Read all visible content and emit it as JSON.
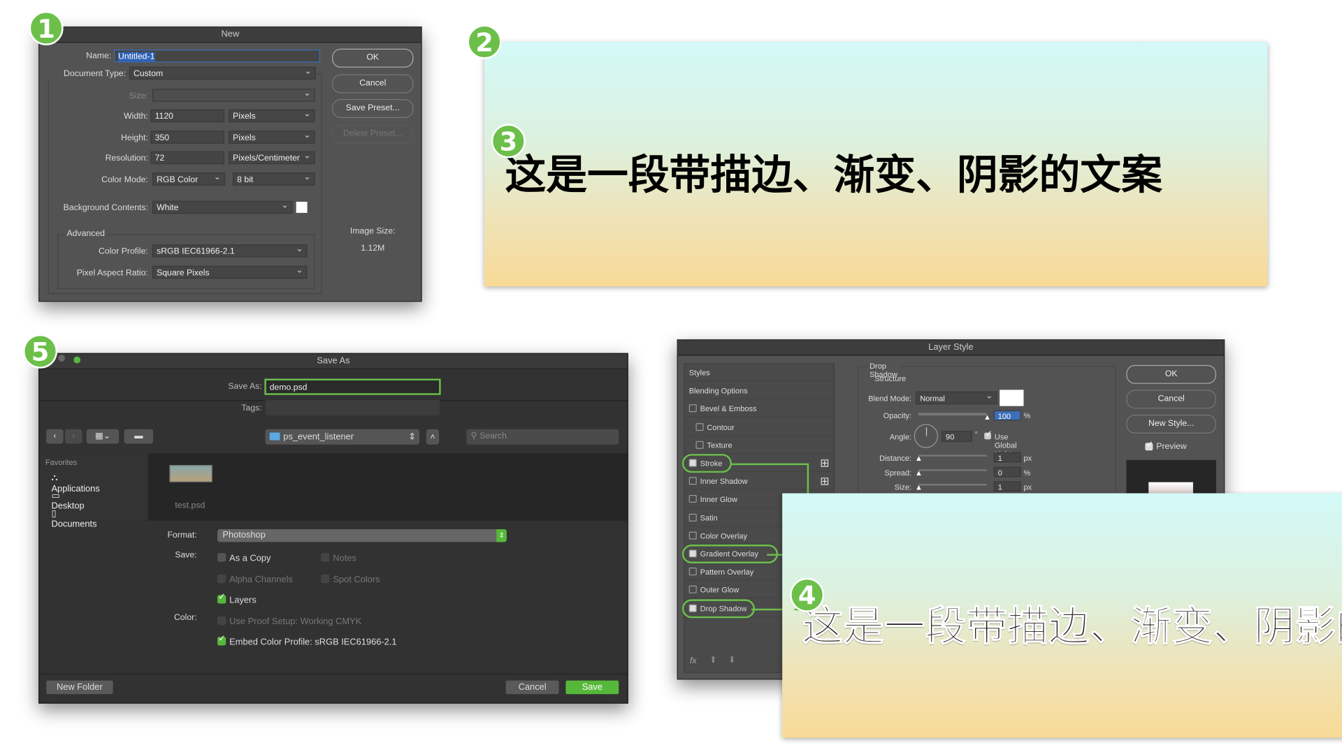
{
  "badges": [
    "1",
    "2",
    "3",
    "4",
    "5"
  ],
  "new_dialog": {
    "title": "New",
    "name_label": "Name:",
    "name_value": "Untitled-1",
    "doc_type_label": "Document Type:",
    "doc_type_value": "Custom",
    "size_label": "Size:",
    "width_label": "Width:",
    "width_value": "1120",
    "width_unit": "Pixels",
    "height_label": "Height:",
    "height_value": "350",
    "height_unit": "Pixels",
    "resolution_label": "Resolution:",
    "resolution_value": "72",
    "resolution_unit": "Pixels/Centimeter",
    "color_mode_label": "Color Mode:",
    "color_mode_value": "RGB Color",
    "bit_depth": "8 bit",
    "bg_label": "Background Contents:",
    "bg_value": "White",
    "advanced_label": "Advanced",
    "profile_label": "Color Profile:",
    "profile_value": "sRGB IEC61966-2.1",
    "par_label": "Pixel Aspect Ratio:",
    "par_value": "Square Pixels",
    "ok": "OK",
    "cancel": "Cancel",
    "save_preset": "Save Preset...",
    "delete_preset": "Delete Preset...",
    "image_size_label": "Image Size:",
    "image_size_value": "1.12M"
  },
  "banner_text": "这是一段带描边、渐变、阴影的文案",
  "save_as": {
    "title": "Save As",
    "save_as_label": "Save As:",
    "save_as_value": "demo.psd",
    "tags_label": "Tags:",
    "location": "ps_event_listener",
    "search_placeholder": "Search",
    "favorites_label": "Favorites",
    "favorites": [
      "Applications",
      "Desktop",
      "Documents"
    ],
    "file": "test.psd",
    "format_label": "Format:",
    "format_value": "Photoshop",
    "save_label": "Save:",
    "options": {
      "as_copy": "As a Copy",
      "notes": "Notes",
      "alpha": "Alpha Channels",
      "spot": "Spot Colors",
      "layers": "Layers"
    },
    "color_label": "Color:",
    "proof": "Use Proof Setup:  Working CMYK",
    "embed": "Embed Color Profile:  sRGB IEC61966-2.1",
    "new_folder": "New Folder",
    "cancel": "Cancel",
    "save": "Save"
  },
  "layer_style": {
    "title": "Layer Style",
    "items": [
      {
        "label": "Styles",
        "checkbox": false
      },
      {
        "label": "Blending Options",
        "checkbox": false
      },
      {
        "label": "Bevel & Emboss",
        "checkbox": true,
        "checked": false
      },
      {
        "label": "Contour",
        "checkbox": true,
        "checked": false,
        "indent": true
      },
      {
        "label": "Texture",
        "checkbox": true,
        "checked": false,
        "indent": true
      },
      {
        "label": "Stroke",
        "checkbox": true,
        "checked": true,
        "highlight": true,
        "plus": true
      },
      {
        "label": "Inner Shadow",
        "checkbox": true,
        "checked": false,
        "plus": true
      },
      {
        "label": "Inner Glow",
        "checkbox": true,
        "checked": false
      },
      {
        "label": "Satin",
        "checkbox": true,
        "checked": false
      },
      {
        "label": "Color Overlay",
        "checkbox": true,
        "checked": false
      },
      {
        "label": "Gradient Overlay",
        "checkbox": true,
        "checked": true,
        "highlight": true
      },
      {
        "label": "Pattern Overlay",
        "checkbox": true,
        "checked": false
      },
      {
        "label": "Outer Glow",
        "checkbox": true,
        "checked": false
      },
      {
        "label": "Drop Shadow",
        "checkbox": true,
        "checked": true,
        "highlight": true
      }
    ],
    "section": "Drop Shadow",
    "structure": "Structure",
    "blend_label": "Blend Mode:",
    "blend_value": "Normal",
    "opacity_label": "Opacity:",
    "opacity_value": "100",
    "opacity_unit": "%",
    "angle_label": "Angle:",
    "angle_value": "90",
    "angle_unit": "°",
    "global_light": "Use Global Light",
    "distance_label": "Distance:",
    "distance_value": "1",
    "distance_unit": "px",
    "spread_label": "Spread:",
    "spread_value": "0",
    "spread_unit": "%",
    "size_label": "Size:",
    "size_value": "1",
    "size_unit": "px",
    "ok": "OK",
    "cancel": "Cancel",
    "new_style": "New Style...",
    "preview": "Preview",
    "fx": "fx"
  },
  "colors": {
    "accent_green": "#6cc04a",
    "dialog_bg": "#535353",
    "save_as_bg": "#323232"
  }
}
